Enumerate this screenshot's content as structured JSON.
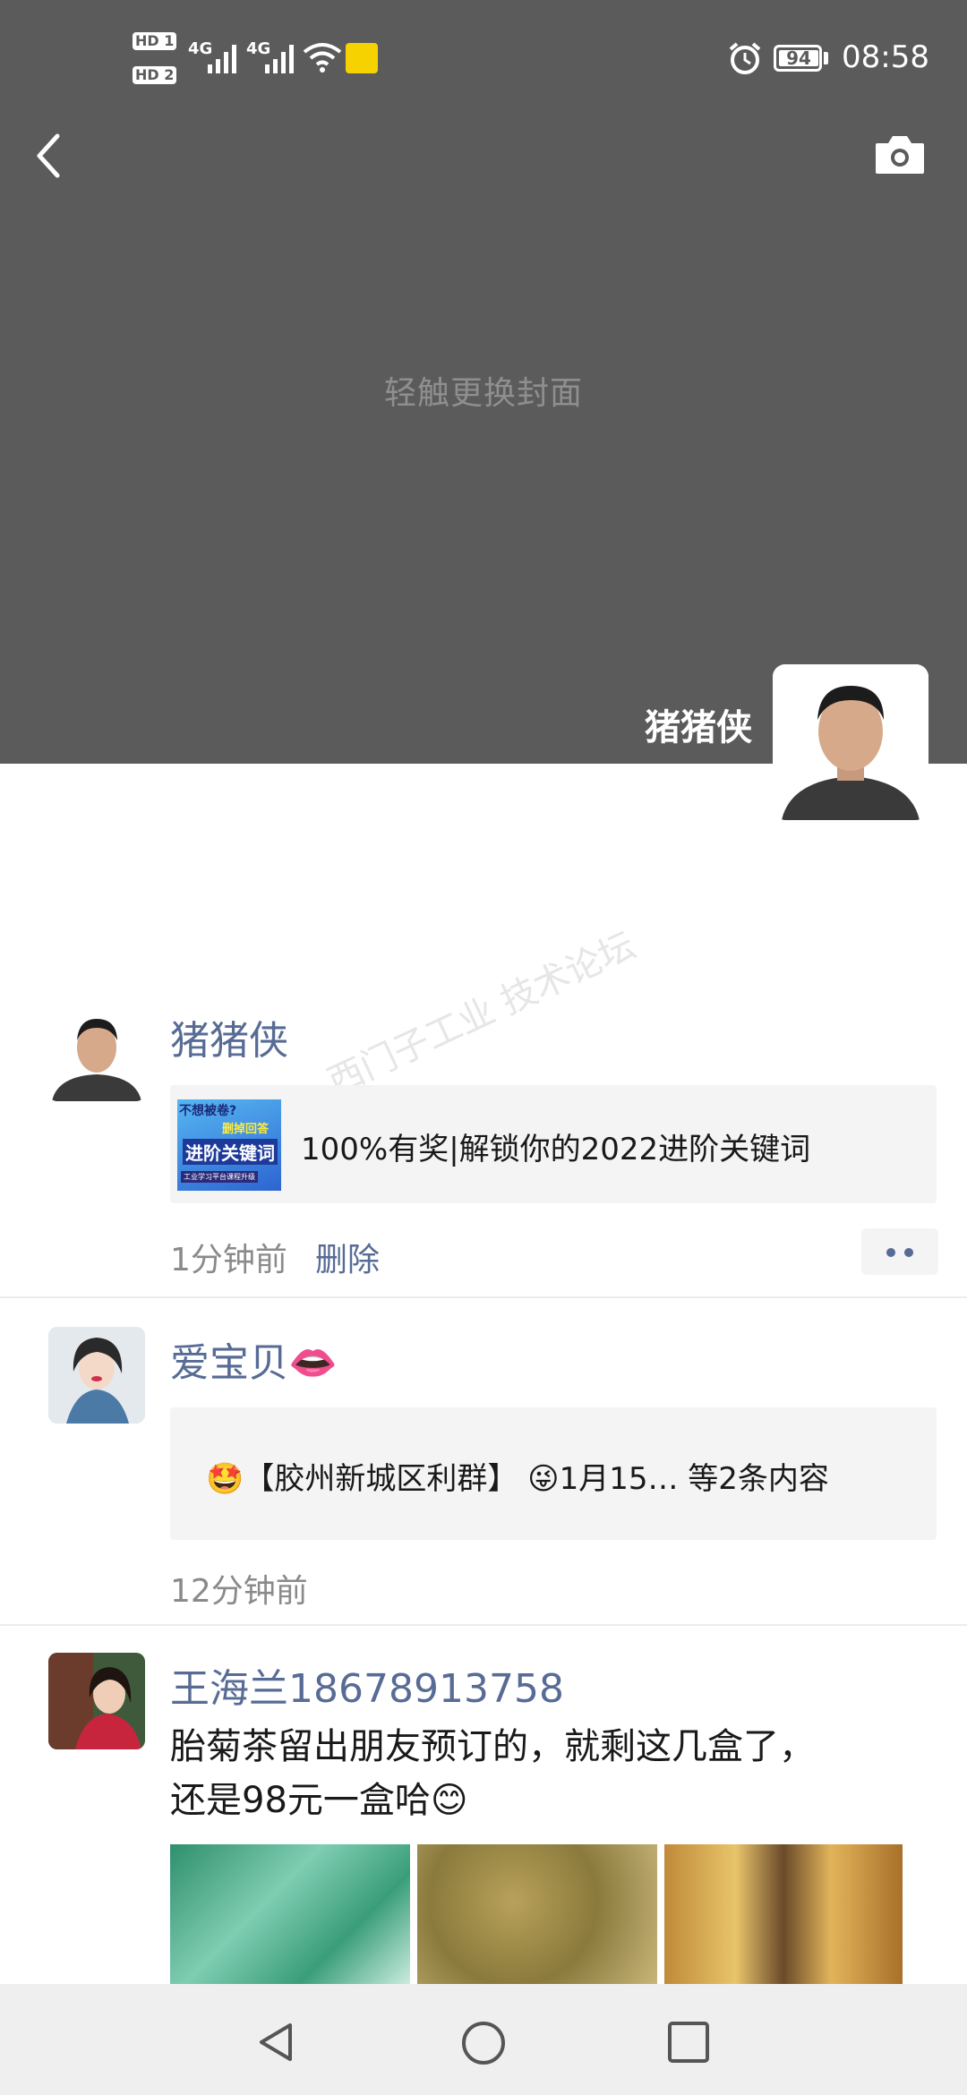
{
  "status_bar": {
    "hd1": "HD 1",
    "hd2": "HD 2",
    "net1": "4G",
    "net2": "4G",
    "battery": "94",
    "time": "08:58",
    "icons": [
      "hd-icon",
      "signal-icon",
      "wifi-icon",
      "alarm-icon",
      "battery-icon"
    ]
  },
  "header": {
    "back_icon": "chevron-left-icon",
    "camera_icon": "camera-icon",
    "cover_hint": "轻触更换封面",
    "profile_name": "猪猪侠"
  },
  "posts": [
    {
      "author": "猪猪侠",
      "link_title": "100%有奖|解锁你的2022进阶关键词",
      "thumb_texts": [
        "不想被卷?",
        "删掉回答",
        "进阶关键词",
        "工业学习平台课程升级"
      ],
      "time": "1分钟前",
      "delete_label": "删除",
      "more_icon": "more-dots-icon"
    },
    {
      "author": "爱宝贝👄",
      "share_text": "🤩【胶州新城区利群】 😜1月15…  等2条内容",
      "time": "12分钟前"
    },
    {
      "author": "王海兰18678913758",
      "text_line1": "胎菊茶留出朋友预订的，就剩这几盒了，",
      "text_line2": "还是98元一盒哈😊"
    }
  ],
  "watermark": "西门子工业 技术论坛",
  "nav_bar": {
    "icons": [
      "nav-back-icon",
      "nav-home-icon",
      "nav-recents-icon"
    ]
  },
  "colors": {
    "cover": "#5b5b5b",
    "link_blue": "#576b95",
    "nav_bg": "#efefef"
  }
}
